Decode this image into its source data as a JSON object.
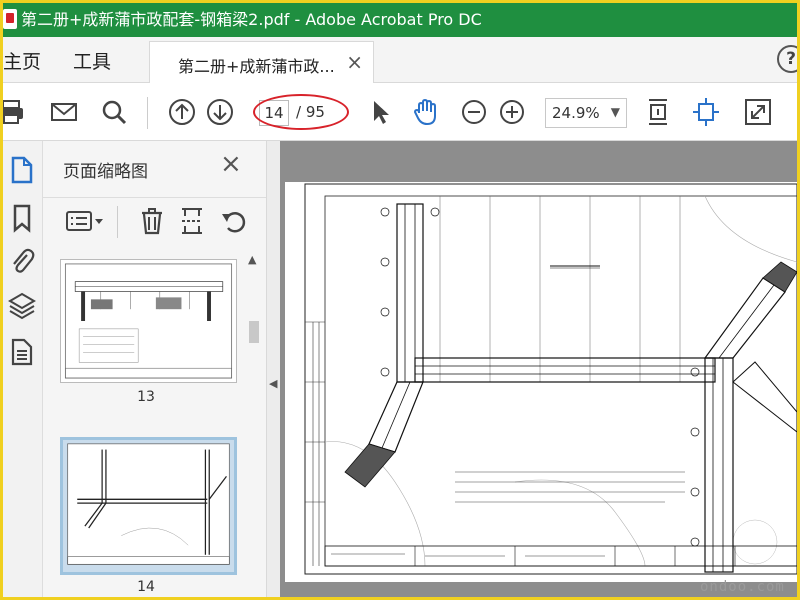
{
  "window": {
    "title": "第二册+成新蒲市政配套-钢箱梁2.pdf - Adobe Acrobat Pro DC"
  },
  "tabs": {
    "home": "主页",
    "tools": "工具",
    "document": "第二册+成新蒲市政...",
    "close_glyph": "×",
    "help_glyph": "?"
  },
  "toolbar": {
    "current_page": "14",
    "total_pages": "/ 95",
    "zoom": "24.9%",
    "icons": [
      "print-icon",
      "email-icon",
      "search-icon",
      "previous-page-icon",
      "next-page-icon",
      "select-cursor-icon",
      "hand-tool-icon",
      "zoom-out-icon",
      "zoom-in-icon",
      "fit-page-icon",
      "rotate-view-icon",
      "fullscreen-icon"
    ]
  },
  "rail": {
    "icons": [
      "page-thumbnails-icon",
      "bookmarks-icon",
      "attachments-icon",
      "layers-icon",
      "page-info-icon"
    ]
  },
  "thumbnails_panel": {
    "title": "页面缩略图",
    "close_glyph": "×",
    "icons": [
      "options-menu-icon",
      "delete-icon",
      "insert-page-icon",
      "undo-icon"
    ],
    "pages": [
      {
        "number": "13",
        "selected": false
      },
      {
        "number": "14",
        "selected": true
      }
    ]
  },
  "document": {
    "watermark": "ondoo.com"
  },
  "colors": {
    "titlebar": "#1f8f40",
    "highlight_oval": "#d8222a",
    "accent_blue": "#2a72c9",
    "outer_frame": "#f0d020"
  }
}
